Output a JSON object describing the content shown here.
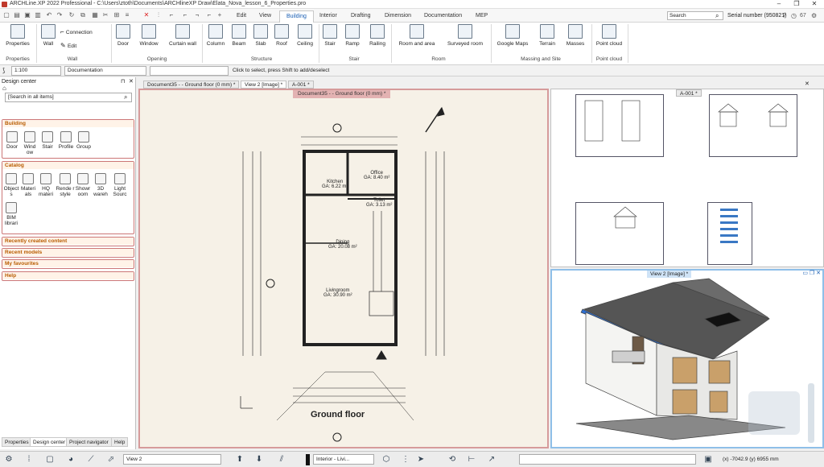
{
  "window": {
    "title": "ARCHLine.XP 2022 Professional - C:\\Users\\ztoth\\Documents\\ARCHlineXP Draw\\Elata_Nova_lesson_6_Properties.pro"
  },
  "tabs": [
    "Edit",
    "View",
    "Building",
    "Interior",
    "Drafting",
    "Dimension",
    "Documentation",
    "MEP"
  ],
  "active_tab": "Building",
  "search": {
    "placeholder": "Search"
  },
  "serial": "Serial number (950821)",
  "notification_count": "67",
  "ribbon": {
    "properties": "Properties",
    "wall": "Wall",
    "connection": "Connection",
    "edit": "Edit",
    "door": "Door",
    "window": "Window",
    "curtain_wall": "Curtain wall",
    "column": "Column",
    "beam": "Beam",
    "slab": "Slab",
    "roof": "Roof",
    "ceiling": "Ceiling",
    "stair": "Stair",
    "ramp": "Ramp",
    "railing": "Railing",
    "room_and_area": "Room and area",
    "surveyed_room": "Surveyed room",
    "google_maps": "Google Maps",
    "terrain": "Terrain",
    "masses": "Masses",
    "point_cloud": "Point cloud",
    "groups": {
      "properties": "Properties",
      "wall": "Wall",
      "opening": "Opening",
      "structure": "Structure",
      "stair": "Stair",
      "room": "Room",
      "massing": "Massing and Site",
      "point_cloud": "Point cloud"
    }
  },
  "propbar": {
    "scale": "1:100",
    "layer": "Documentation",
    "hint": "Click to select, press Shift to add/deselect"
  },
  "left_panel": {
    "title": "Design center",
    "search": "[Search in all items]",
    "building": {
      "title": "Building",
      "items": [
        "Door",
        "Wind ow",
        "Stair",
        "Profile",
        "Group"
      ]
    },
    "catalog": {
      "title": "Catalog",
      "items": [
        "Object s",
        "Materi als",
        "HQ materi",
        "Rende r style",
        "Showr oom",
        "3D wareh",
        "Light Sourc",
        "BIM librari"
      ]
    },
    "sections": [
      "Recently created content",
      "Recent models",
      "My favourites",
      "Help"
    ],
    "bottom_tabs": [
      "Properties",
      "Design center",
      "Project navigator",
      "Help"
    ]
  },
  "doc_tabs": [
    "Document35 -   - Ground floor (0 mm) *",
    "View 2 [Image] *",
    "A-001 *"
  ],
  "viewport1": {
    "label": "Document35 -   - Ground floor (0 mm) *",
    "rooms": [
      {
        "name": "Kitchen",
        "area": "GA: 6.22 m²"
      },
      {
        "name": "Office",
        "area": "GA: 8.40 m²"
      },
      {
        "name": "Toilet",
        "area": "GA: 3.13 m²"
      },
      {
        "name": "Dining",
        "area": "GA: 20.08 m²"
      },
      {
        "name": "Livingroom",
        "area": "GA: 30.90 m²"
      }
    ],
    "plan_title": "Ground floor"
  },
  "viewport2": {
    "label": "A-001 *"
  },
  "viewport3": {
    "label": "View 2 [Image] *"
  },
  "bottom": {
    "view": "View 2",
    "layer": "Interior - Livi...",
    "coords": "(x) -7042.9   (y) 6955 mm"
  }
}
